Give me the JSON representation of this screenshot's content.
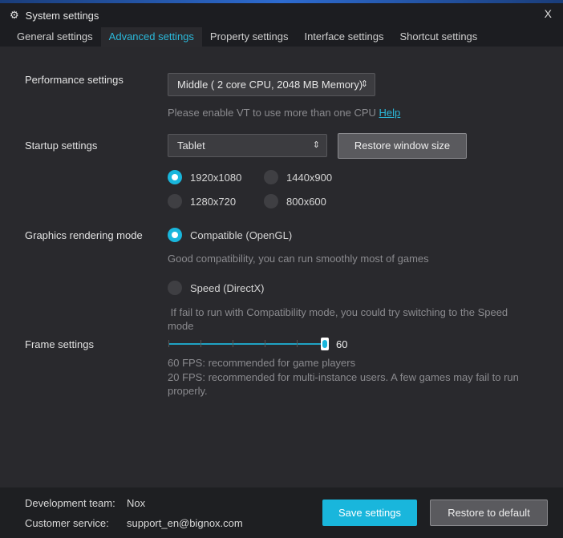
{
  "window": {
    "title": "System settings",
    "close": "X"
  },
  "tabs": [
    {
      "label": "General settings"
    },
    {
      "label": "Advanced settings",
      "active": true
    },
    {
      "label": "Property settings"
    },
    {
      "label": "Interface settings"
    },
    {
      "label": "Shortcut settings"
    }
  ],
  "performance": {
    "label": "Performance settings",
    "value": "Middle ( 2 core CPU, 2048 MB Memory)",
    "hint": "Please enable VT to use more than one CPU",
    "help": "Help"
  },
  "startup": {
    "label": "Startup settings",
    "value": "Tablet",
    "restore": "Restore window size",
    "resolutions": [
      {
        "label": "1920x1080",
        "selected": true
      },
      {
        "label": "1440x900",
        "selected": false
      },
      {
        "label": "1280x720",
        "selected": false
      },
      {
        "label": "800x600",
        "selected": false
      }
    ]
  },
  "graphics": {
    "label": "Graphics rendering mode",
    "opengl": "Compatible (OpenGL)",
    "opengl_hint": "Good compatibility, you can run smoothly most of games",
    "directx": "Speed (DirectX)",
    "directx_hint": " If fail to run with Compatibility mode, you could try switching to the Speed mode",
    "selected": "opengl"
  },
  "frame": {
    "label": "Frame settings",
    "value": "60",
    "fill_fraction": 1.0,
    "hint1": "60 FPS: recommended for game players",
    "hint2": "20 FPS: recommended for multi-instance users. A few games may fail to run properly."
  },
  "footer": {
    "dev_label": "Development team:",
    "dev_value": "Nox",
    "cs_label": "Customer service:",
    "cs_value": "support_en@bignox.com",
    "save": "Save settings",
    "restore": "Restore to default"
  },
  "colors": {
    "accent": "#19b6dc",
    "panel": "#29292d"
  }
}
